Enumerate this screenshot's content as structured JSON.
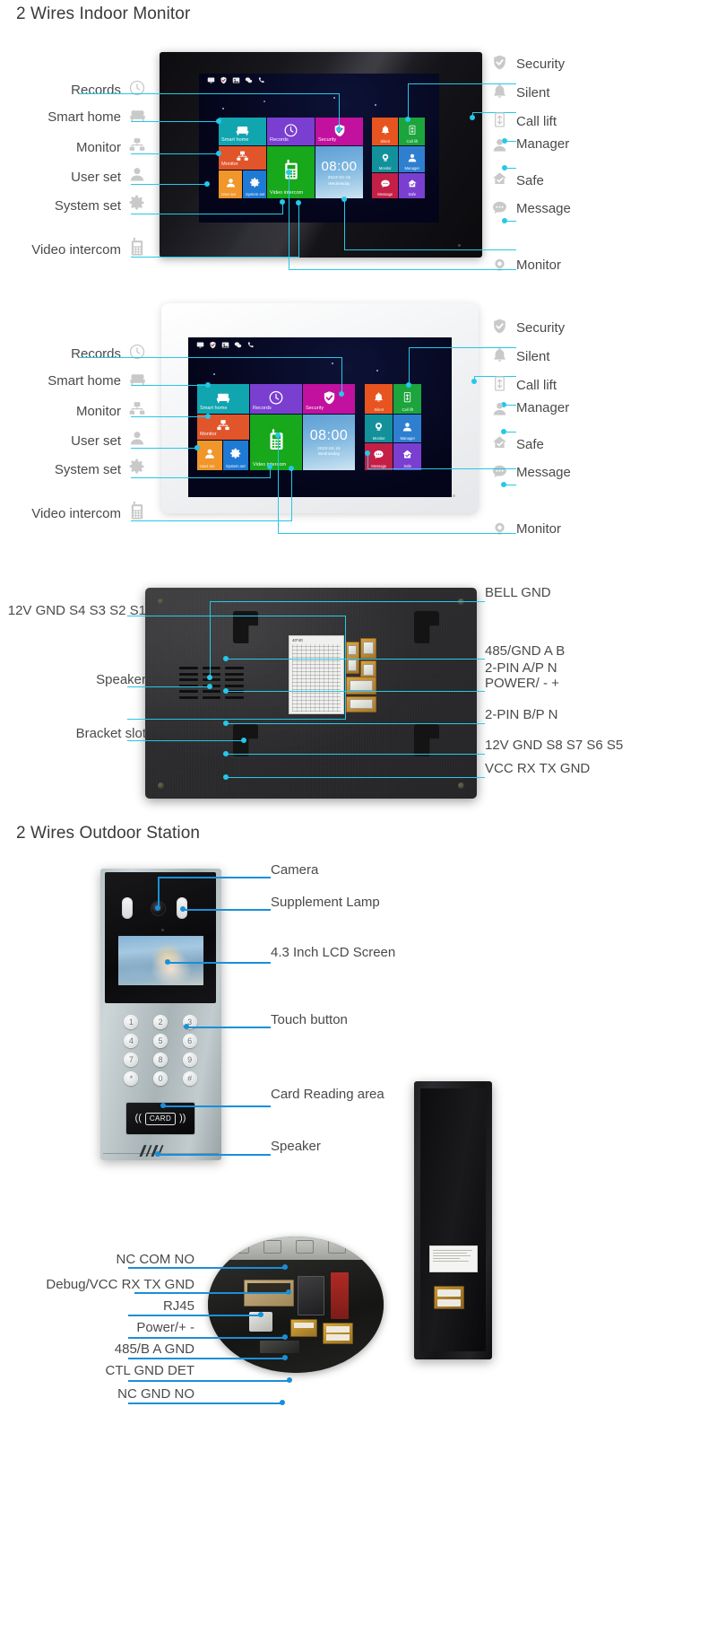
{
  "sections": {
    "indoor_title": "2 Wires Indoor Monitor",
    "outdoor_title": "2 Wires Outdoor Station"
  },
  "indoor_monitor": {
    "screen": {
      "status_icons": [
        "monitor-icon",
        "shield-check-icon",
        "picture-icon",
        "chat-icon",
        "phone-icon"
      ],
      "clock": {
        "time": "08:00",
        "date": "2023-02-15",
        "weekday": "Wednesday"
      },
      "tiles": [
        {
          "label": "Smart home",
          "color": "#11a5b0",
          "icon": "sofa-icon"
        },
        {
          "label": "Records",
          "color": "#7a3fd0",
          "icon": "clock-icon"
        },
        {
          "label": "Security",
          "color": "#c2119e",
          "icon": "shield-check-icon"
        },
        {
          "label": "Monitor",
          "color": "#e0552a",
          "icon": "network-icon"
        },
        {
          "label": "Video intercom",
          "color": "#17a81b",
          "icon": "handset-icon"
        },
        {
          "label": "User set",
          "color": "#f0962a",
          "icon": "user-icon"
        },
        {
          "label": "System set",
          "color": "#1f7ad4",
          "icon": "gear-icon"
        },
        {
          "label": "Silent",
          "color": "#e8541f",
          "icon": "bell-icon"
        },
        {
          "label": "Call lift",
          "color": "#1ba53c",
          "icon": "lift-icon"
        },
        {
          "label": "Monitor",
          "color": "#12919b",
          "icon": "camera-icon"
        },
        {
          "label": "Manager",
          "color": "#2f7fd1",
          "icon": "user-icon"
        },
        {
          "label": "Message",
          "color": "#c41f46",
          "icon": "message-icon"
        },
        {
          "label": "Safe",
          "color": "#7a3fd0",
          "icon": "safe-home-icon"
        }
      ]
    },
    "left_labels": [
      {
        "text": "Records",
        "icon": "clock-icon"
      },
      {
        "text": "Smart home",
        "icon": "sofa-icon"
      },
      {
        "text": "Monitor",
        "icon": "network-icon"
      },
      {
        "text": "User set",
        "icon": "user-icon"
      },
      {
        "text": "System set",
        "icon": "gear-icon"
      },
      {
        "text": "Video intercom",
        "icon": "handset-icon"
      }
    ],
    "right_labels": [
      {
        "text": "Security",
        "icon": "shield-check-icon"
      },
      {
        "text": "Silent",
        "icon": "bell-icon"
      },
      {
        "text": "Call lift",
        "icon": "lift-icon"
      },
      {
        "text": "Manager",
        "icon": "user-icon"
      },
      {
        "text": "Safe",
        "icon": "safe-home-icon"
      },
      {
        "text": "Message",
        "icon": "message-icon"
      },
      {
        "text": "Monitor",
        "icon": "camera-icon"
      }
    ]
  },
  "back_panel": {
    "wiring_label_title": "40*40",
    "left_labels": [
      {
        "text": "12V GND S4 S3 S2 S1"
      },
      {
        "text": "Speaker"
      },
      {
        "text": "Bracket slot"
      }
    ],
    "right_labels": [
      {
        "text": "BELL GND"
      },
      {
        "text": "485/GND A B"
      },
      {
        "text": "2-PIN A/P N"
      },
      {
        "text": "POWER/ - +"
      },
      {
        "text": "2-PIN B/P N"
      },
      {
        "text": "12V GND S8 S7 S6 S5"
      },
      {
        "text": "VCC  RX TX GND"
      }
    ]
  },
  "outdoor_station": {
    "keypad": [
      "1",
      "2",
      "3",
      "4",
      "5",
      "6",
      "7",
      "8",
      "9",
      "*",
      "0",
      "#"
    ],
    "card_text": "CARD",
    "right_labels": [
      {
        "text": "Camera"
      },
      {
        "text": "Supplement Lamp"
      },
      {
        "text": "4.3 Inch LCD Screen"
      },
      {
        "text": "Touch button"
      },
      {
        "text": "Card Reading area"
      },
      {
        "text": "Speaker"
      }
    ],
    "pcb_labels": [
      {
        "text": "NC COM NO"
      },
      {
        "text": "Debug/VCC RX TX GND"
      },
      {
        "text": "RJ45"
      },
      {
        "text": "Power/+ -"
      },
      {
        "text": "485/B A GND"
      },
      {
        "text": "CTL GND DET"
      },
      {
        "text": "NC GND NO"
      }
    ]
  },
  "colors": {
    "leader_cyan": "#25c8e8",
    "leader_blue": "#1a8fd8",
    "label_text": "#4a4a4a",
    "icon_grey": "#c9c9c9"
  }
}
